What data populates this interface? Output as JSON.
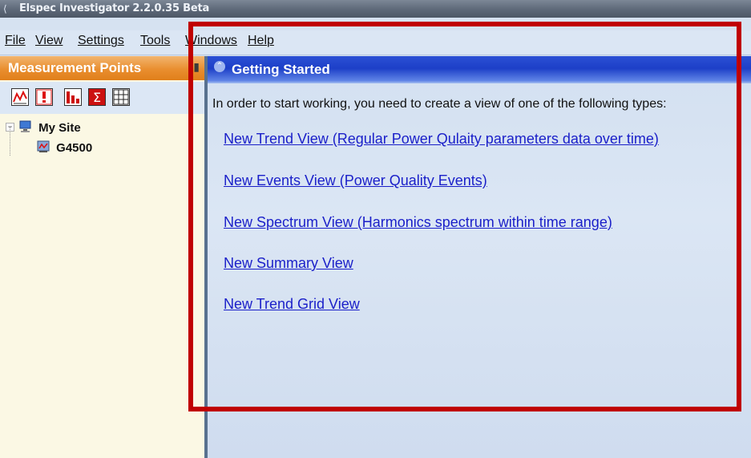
{
  "titlebar": {
    "icon": "app-icon",
    "title": "Elspec Investigator 2.2.0.35 Beta"
  },
  "menubar": {
    "items": [
      {
        "label": "File"
      },
      {
        "label": "View"
      },
      {
        "label": "Settings"
      },
      {
        "label": "Tools"
      },
      {
        "label": "Windows"
      },
      {
        "label": "Help"
      }
    ]
  },
  "left_pane": {
    "title": "Measurement Points",
    "pin_icon": "pin-icon",
    "toolbar": [
      "trend-view-icon",
      "events-view-icon",
      "spectrum-view-icon",
      "summary-view-icon",
      "trend-grid-view-icon"
    ],
    "tree": {
      "root": {
        "label": "My Site",
        "icon": "computer-icon"
      },
      "children": [
        {
          "label": "G4500",
          "icon": "device-icon"
        }
      ]
    }
  },
  "right_pane": {
    "header": "Getting Started",
    "intro": "In order to start working, you need to create a view of one of the following types:",
    "links": [
      {
        "label": "New Trend View (Regular Power Qulaity parameters data over time)"
      },
      {
        "label": "New Events View (Power Quality Events)"
      },
      {
        "label": "New Spectrum View (Harmonics spectrum within time range)"
      },
      {
        "label": "New Summary View"
      },
      {
        "label": "New Trend Grid View"
      }
    ]
  },
  "colors": {
    "highlight": "#c00000",
    "panel_header_orange": "#e98e2f",
    "panel_header_blue": "#1d3fc8",
    "link": "#1a1fc9"
  }
}
